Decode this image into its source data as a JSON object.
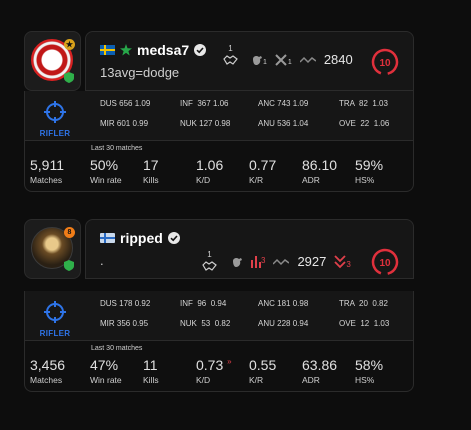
{
  "players": [
    {
      "name": "medsa7",
      "subtitle": "13avg=dodge",
      "badge_level_text": "",
      "highlight_count": "1",
      "stat_icon_sub1": "1",
      "stat_icon_sub2": "1",
      "elo": "2840",
      "level": "10",
      "role": "RIFLER",
      "rows": {
        "dus": {
          "label": "DUS",
          "count": "656",
          "ratio": "1.09"
        },
        "mir": {
          "label": "MIR",
          "count": "601",
          "ratio": "0.99"
        },
        "inf": {
          "label": "INF",
          "count": "367",
          "ratio": "1.06"
        },
        "nuk": {
          "label": "NUK",
          "count": "127",
          "ratio": "0.98"
        },
        "anc": {
          "label": "ANC",
          "count": "743",
          "ratio": "1.09"
        },
        "anu": {
          "label": "ANU",
          "count": "536",
          "ratio": "1.04"
        },
        "tra": {
          "label": "TRA",
          "count": "82",
          "ratio": "1.03"
        },
        "ove": {
          "label": "OVE",
          "count": "22",
          "ratio": "1.06"
        }
      },
      "recent_title": "Last 30 matches",
      "matches": {
        "value": "5,911",
        "label": "Matches"
      },
      "winrate": {
        "value": "50%",
        "label": "Win rate"
      },
      "kills": {
        "value": "17",
        "label": "Kills"
      },
      "kd": {
        "value": "1.06",
        "label": "K/D"
      },
      "kr": {
        "value": "0.77",
        "label": "K/R"
      },
      "adr": {
        "value": "86.10",
        "label": "ADR"
      },
      "hs": {
        "value": "59%",
        "label": "HS%"
      }
    },
    {
      "name": "ripped",
      "subtitle": ".",
      "badge_level_text": "8",
      "highlight_count": "1",
      "bar_sub": "3",
      "elo": "2927",
      "elo_drop": "3",
      "level": "10",
      "role": "RIFLER",
      "rows": {
        "dus": {
          "label": "DUS",
          "count": "178",
          "ratio": "0.92"
        },
        "mir": {
          "label": "MIR",
          "count": "356",
          "ratio": "0.95"
        },
        "inf": {
          "label": "INF",
          "count": "96",
          "ratio": "0.94"
        },
        "nuk": {
          "label": "NUK",
          "count": "53",
          "ratio": "0.82"
        },
        "anc": {
          "label": "ANC",
          "count": "181",
          "ratio": "0.98"
        },
        "anu": {
          "label": "ANU",
          "count": "228",
          "ratio": "0.94"
        },
        "tra": {
          "label": "TRA",
          "count": "20",
          "ratio": "0.82"
        },
        "ove": {
          "label": "OVE",
          "count": "12",
          "ratio": "1.03"
        }
      },
      "recent_title": "Last 30 matches",
      "matches": {
        "value": "3,456",
        "label": "Matches"
      },
      "winrate": {
        "value": "47%",
        "label": "Win rate"
      },
      "kills": {
        "value": "11",
        "label": "Kills"
      },
      "kd": {
        "value": "0.73",
        "label": "K/D"
      },
      "kr": {
        "value": "0.55",
        "label": "K/R"
      },
      "adr": {
        "value": "63.86",
        "label": "ADR"
      },
      "hs": {
        "value": "58%",
        "label": "HS%"
      }
    }
  ],
  "colors": {
    "accent_red": "#e0404a",
    "role_blue": "#2e74e8",
    "level_red": "#e0303c"
  }
}
